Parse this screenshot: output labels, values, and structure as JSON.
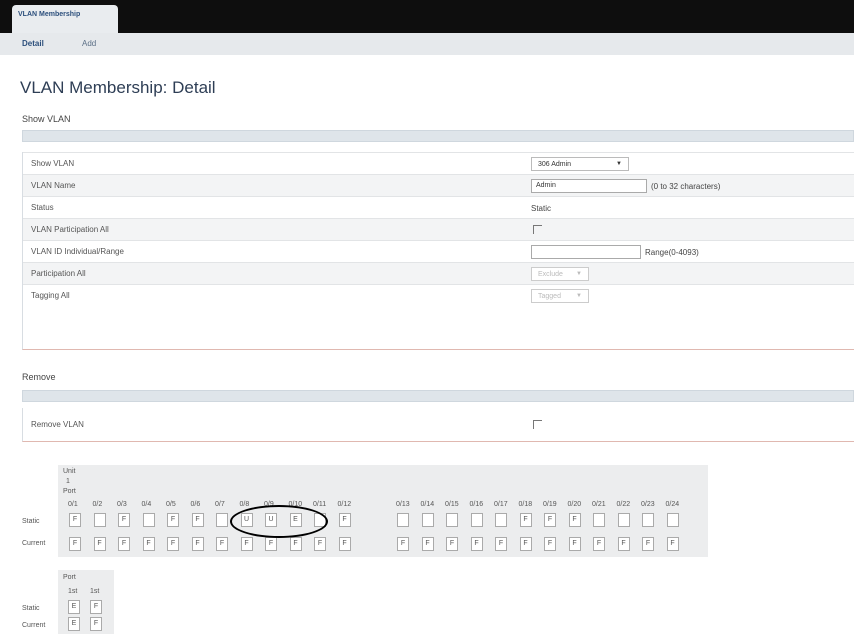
{
  "tab": {
    "active": "VLAN Membership"
  },
  "subnav": {
    "detail": "Detail",
    "add": "Add"
  },
  "page_title": "VLAN Membership: Detail",
  "show_vlan": {
    "section_title": "Show VLAN",
    "rows": [
      {
        "label": "Show VLAN",
        "value": "306 Admin"
      },
      {
        "label": "VLAN Name",
        "value": "Admin",
        "hint": "(0 to 32 characters)"
      },
      {
        "label": "Status",
        "value": "Static"
      },
      {
        "label": "VLAN Participation All"
      },
      {
        "label": "VLAN ID Individual/Range",
        "hint": "Range(0-4093)"
      },
      {
        "label": "Participation All",
        "value": "Exclude"
      },
      {
        "label": "Tagging All",
        "value": "Tagged"
      }
    ]
  },
  "remove": {
    "section_title": "Remove",
    "row_label": "Remove VLAN"
  },
  "ports": {
    "unit_label": "Unit",
    "unit_value": "1",
    "port_label": "Port",
    "static_label": "Static",
    "current_label": "Current",
    "port_names": [
      "0/1",
      "0/2",
      "0/3",
      "0/4",
      "0/5",
      "0/6",
      "0/7",
      "0/8",
      "0/9",
      "0/10",
      "0/11",
      "0/12",
      "0/13",
      "0/14",
      "0/15",
      "0/16",
      "0/17",
      "0/18",
      "0/19",
      "0/20",
      "0/21",
      "0/22",
      "0/23",
      "0/24"
    ],
    "static": [
      "F",
      "",
      "F",
      "",
      "F",
      "F",
      "",
      "U",
      "U",
      "E",
      "",
      "F",
      "",
      "",
      "",
      "",
      "",
      "F",
      "F",
      "F",
      "",
      "",
      "",
      ""
    ],
    "current": [
      "F",
      "F",
      "F",
      "F",
      "F",
      "F",
      "F",
      "F",
      "F",
      "F",
      "F",
      "F",
      "F",
      "F",
      "F",
      "F",
      "F",
      "F",
      "F",
      "F",
      "F",
      "F",
      "F",
      "F"
    ],
    "lag_port_label": "Port",
    "lag_names": [
      "1st",
      "1st"
    ],
    "lag_static": [
      "E",
      "F"
    ],
    "lag_current": [
      "E",
      "F"
    ]
  }
}
